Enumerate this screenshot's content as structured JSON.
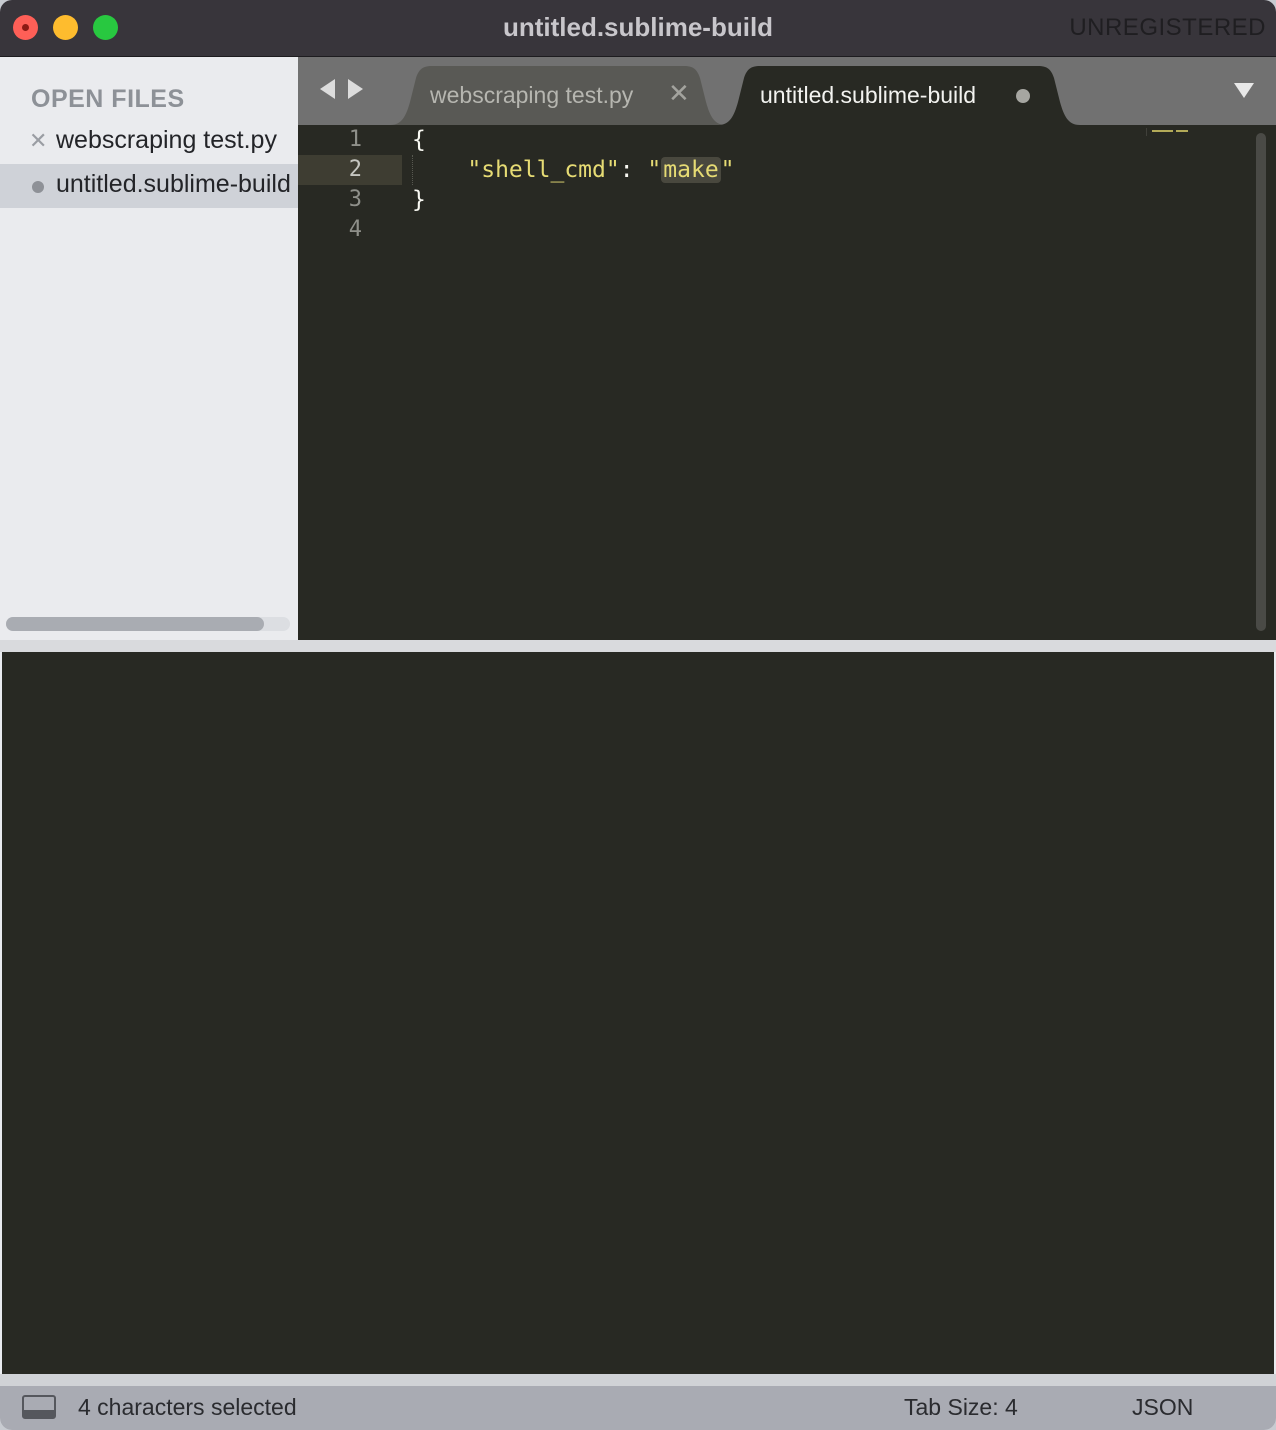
{
  "window": {
    "title": "untitled.sublime-build",
    "license_label": "UNREGISTERED"
  },
  "sidebar": {
    "heading": "OPEN FILES",
    "items": [
      {
        "label": "webscraping test.py",
        "marker": "✕",
        "selected": false
      },
      {
        "label": "untitled.sublime-build",
        "marker": "●",
        "selected": true
      }
    ]
  },
  "tabs": [
    {
      "label": "webscraping test.py",
      "close_glyph": "✕",
      "active": false
    },
    {
      "label": "untitled.sublime-build",
      "dirty": true,
      "active": true
    }
  ],
  "editor": {
    "line_numbers": [
      "1",
      "2",
      "3",
      "4"
    ],
    "active_line": "2",
    "code": {
      "line1": "{",
      "line2_indent": "    ",
      "line2_key": "\"shell_cmd\"",
      "line2_colon": ": ",
      "line2_quote_open": "\"",
      "line2_value": "make",
      "line2_quote_close": "\"",
      "line3": "}",
      "line4": ""
    }
  },
  "status_bar": {
    "selection": "4 characters selected",
    "tab_size": "Tab Size: 4",
    "syntax": "JSON"
  },
  "colors": {
    "editor_bg": "#282923",
    "string": "#e6db74",
    "line_highlight": "#3e3d32",
    "selection": "#49483e",
    "title_bar": "#38353b"
  }
}
